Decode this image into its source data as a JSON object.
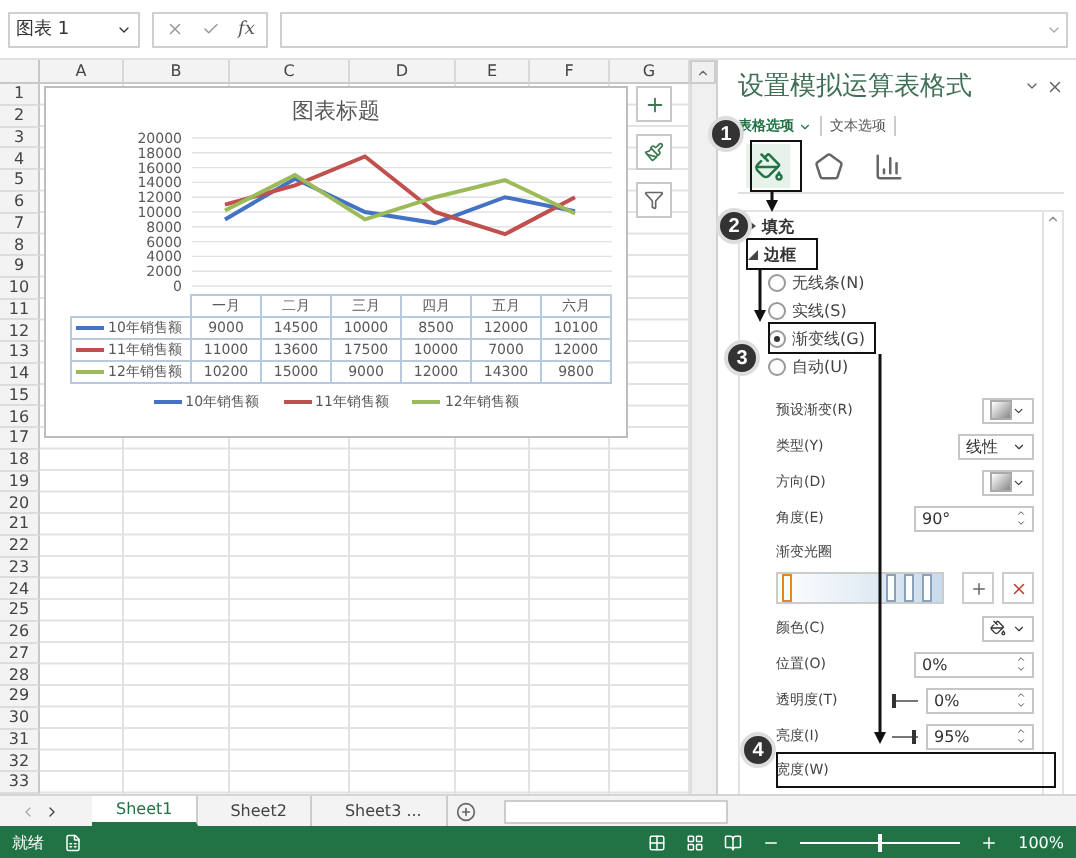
{
  "formula_bar": {
    "name_box": "图表 1",
    "function_label": "fx"
  },
  "sheet": {
    "columns": [
      "A",
      "B",
      "C",
      "D",
      "E",
      "F",
      "G"
    ],
    "row_numbers": [
      "1",
      "2",
      "3",
      "4",
      "5",
      "6",
      "7",
      "8",
      "9",
      "10",
      "11",
      "12",
      "13",
      "14",
      "15",
      "16",
      "17",
      "18",
      "19",
      "20",
      "21",
      "22",
      "23",
      "24",
      "25",
      "26",
      "27",
      "28",
      "29",
      "30",
      "31",
      "32",
      "33"
    ]
  },
  "chart": {
    "title": "图表标题",
    "chart_data": {
      "type": "line",
      "categories": [
        "一月",
        "二月",
        "三月",
        "四月",
        "五月",
        "六月"
      ],
      "ylim": [
        0,
        20000
      ],
      "yticks": [
        0,
        2000,
        4000,
        6000,
        8000,
        10000,
        12000,
        14000,
        16000,
        18000,
        20000
      ],
      "grid": true,
      "legend": "bottom",
      "series": [
        {
          "name": "10年销售额",
          "color": "#4472c4",
          "values": [
            9000,
            14500,
            10000,
            8500,
            12000,
            10100
          ]
        },
        {
          "name": "11年销售额",
          "color": "#c0504d",
          "values": [
            11000,
            13600,
            17500,
            10000,
            7000,
            12000
          ]
        },
        {
          "name": "12年销售额",
          "color": "#9bbb59",
          "values": [
            10200,
            15000,
            9000,
            12000,
            14300,
            9800
          ]
        }
      ]
    },
    "data_table": [
      {
        "cells": [
          "9000",
          "14500",
          "10000",
          "8500",
          "12000",
          "10100"
        ]
      },
      {
        "cells": [
          "11000",
          "13600",
          "17500",
          "10000",
          "7000",
          "12000"
        ]
      },
      {
        "cells": [
          "10200",
          "15000",
          "9000",
          "12000",
          "14300",
          "9800"
        ]
      }
    ],
    "legend": [
      {
        "label": "10年销售额",
        "color": "#4472c4"
      },
      {
        "label": "11年销售额",
        "color": "#c0504d"
      },
      {
        "label": "12年销售额",
        "color": "#9bbb59"
      }
    ]
  },
  "panel": {
    "title": "设置模拟运算表格式",
    "tabs": [
      {
        "label": "表格选项",
        "selected": true
      },
      {
        "label": "文本选项",
        "selected": false
      }
    ],
    "icon_tabs": [
      {
        "kind": "fill",
        "selected": true
      },
      {
        "kind": "shape",
        "selected": false
      },
      {
        "kind": "chart",
        "selected": false
      }
    ],
    "sections": [
      {
        "label": "填充",
        "expanded": false
      },
      {
        "label": "边框",
        "expanded": true
      }
    ],
    "line_options": [
      {
        "label": "无线条(N)",
        "selected": false
      },
      {
        "label": "实线(S)",
        "selected": false
      },
      {
        "label": "渐变线(G)",
        "selected": true
      },
      {
        "label": "自动(U)",
        "selected": false
      }
    ],
    "rows": [
      {
        "kind": "swatch",
        "label": "预设渐变(R)"
      },
      {
        "kind": "select",
        "label": "类型(Y)",
        "value": "线性"
      },
      {
        "kind": "swatch",
        "label": "方向(D)"
      },
      {
        "kind": "spin",
        "label": "角度(E)",
        "value": "90°"
      },
      {
        "kind": "heading",
        "label": "渐变光圈"
      },
      {
        "kind": "stops",
        "stops": [
          {
            "selected": true
          },
          {
            "selected": false
          },
          {
            "selected": false
          },
          {
            "selected": false
          }
        ]
      },
      {
        "kind": "color",
        "label": "颜色(C)"
      },
      {
        "kind": "spin",
        "label": "位置(O)",
        "value": "0%"
      },
      {
        "kind": "slider",
        "label": "透明度(T)",
        "value": "0%",
        "level": 0
      },
      {
        "kind": "slider",
        "label": "亮度(I)",
        "value": "95%",
        "level": 0.95
      },
      {
        "kind": "heading",
        "label": "宽度(W)"
      }
    ]
  },
  "callouts": [
    "1",
    "2",
    "3",
    "4"
  ],
  "sheet_tabs": [
    {
      "label": "Sheet1",
      "selected": true
    },
    {
      "label": "Sheet2",
      "selected": false
    },
    {
      "label": "Sheet3 ...",
      "selected": false
    }
  ],
  "status_bar": {
    "status": "就绪",
    "zoom": "100%",
    "zoom_slider": {
      "level": 0.5
    }
  }
}
